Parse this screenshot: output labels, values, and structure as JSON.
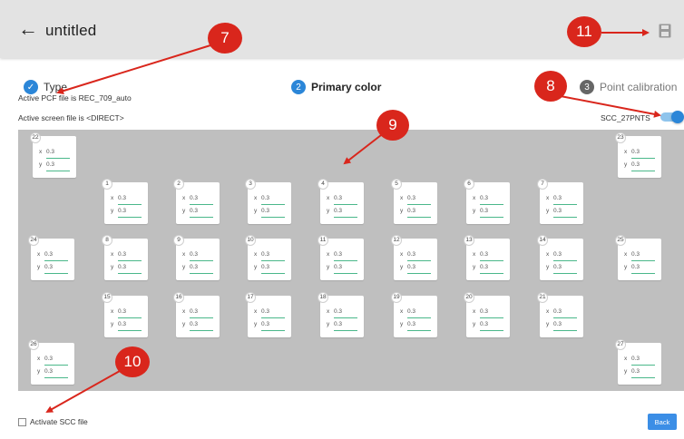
{
  "header": {
    "title": "untitled",
    "back_icon": "arrow-left-icon",
    "save_icon": "save-icon"
  },
  "steps": [
    {
      "number": "✓",
      "label": "Type"
    },
    {
      "number": "2",
      "label": "Primary color"
    },
    {
      "number": "3",
      "label": "Point calibration"
    }
  ],
  "info": {
    "pcf_file": "Active PCF file is REC_709_auto",
    "screen_file": "Active screen file is <DIRECT>"
  },
  "toggle": {
    "label": "SCC_27PNTS",
    "on": true
  },
  "points": [
    {
      "num": "22",
      "x": "0.3",
      "y": "0.3"
    },
    {
      "num": "23",
      "x": "0.3",
      "y": "0.3"
    },
    {
      "num": "1",
      "x": "0.3",
      "y": "0.3"
    },
    {
      "num": "2",
      "x": "0.3",
      "y": "0.3"
    },
    {
      "num": "3",
      "x": "0.3",
      "y": "0.3"
    },
    {
      "num": "4",
      "x": "0.3",
      "y": "0.3"
    },
    {
      "num": "5",
      "x": "0.3",
      "y": "0.3"
    },
    {
      "num": "6",
      "x": "0.3",
      "y": "0.3"
    },
    {
      "num": "7",
      "x": "0.3",
      "y": "0.3"
    },
    {
      "num": "24",
      "x": "0.3",
      "y": "0.3"
    },
    {
      "num": "8",
      "x": "0.3",
      "y": "0.3"
    },
    {
      "num": "9",
      "x": "0.3",
      "y": "0.3"
    },
    {
      "num": "10",
      "x": "0.3",
      "y": "0.3"
    },
    {
      "num": "11",
      "x": "0.3",
      "y": "0.3"
    },
    {
      "num": "12",
      "x": "0.3",
      "y": "0.3"
    },
    {
      "num": "13",
      "x": "0.3",
      "y": "0.3"
    },
    {
      "num": "14",
      "x": "0.3",
      "y": "0.3"
    },
    {
      "num": "25",
      "x": "0.3",
      "y": "0.3"
    },
    {
      "num": "15",
      "x": "0.3",
      "y": "0.3"
    },
    {
      "num": "16",
      "x": "0.3",
      "y": "0.3"
    },
    {
      "num": "17",
      "x": "0.3",
      "y": "0.3"
    },
    {
      "num": "18",
      "x": "0.3",
      "y": "0.3"
    },
    {
      "num": "19",
      "x": "0.3",
      "y": "0.3"
    },
    {
      "num": "20",
      "x": "0.3",
      "y": "0.3"
    },
    {
      "num": "21",
      "x": "0.3",
      "y": "0.3"
    },
    {
      "num": "26",
      "x": "0.3",
      "y": "0.3"
    },
    {
      "num": "27",
      "x": "0.3",
      "y": "0.3"
    }
  ],
  "field_labels": {
    "x": "x",
    "y": "y"
  },
  "callouts": [
    "7",
    "8",
    "9",
    "10",
    "11"
  ],
  "footer": {
    "checkbox_label": "Activate SCC file",
    "back_button": "Back"
  },
  "colors": {
    "accent": "#2b86d8",
    "callout": "#d9261c",
    "field_underline": "#4ab88a",
    "grid_background": "#bfbfbf"
  }
}
